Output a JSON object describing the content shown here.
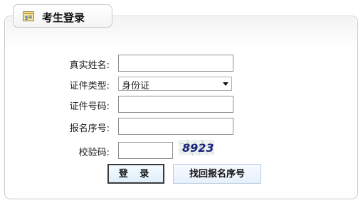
{
  "header": {
    "title": "考生登录",
    "icon": "id-card-icon"
  },
  "form": {
    "name_label": "真实姓名:",
    "name_value": "",
    "id_type_label": "证件类型:",
    "id_type_selected": "身份证",
    "id_number_label": "证件号码:",
    "id_number_value": "",
    "reg_number_label": "报名序号:",
    "reg_number_value": "",
    "captcha_label": "校验码:",
    "captcha_value": "",
    "captcha_text": "8923"
  },
  "buttons": {
    "login_label": "登 录",
    "find_label": "找回报名序号"
  },
  "colors": {
    "border": "#c9c9c9",
    "button_bg": "#e6f0fb",
    "captcha_text": "#1a237e"
  }
}
